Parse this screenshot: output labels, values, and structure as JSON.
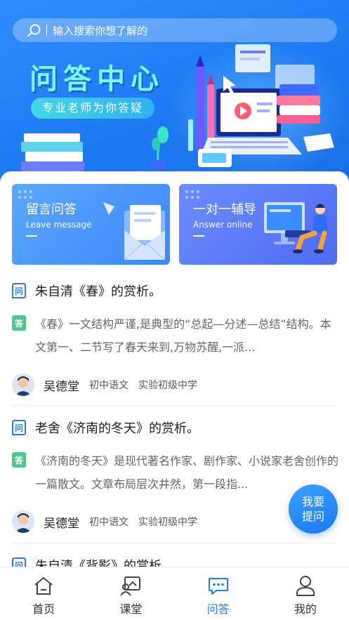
{
  "search": {
    "placeholder": "输入搜索你想了解的"
  },
  "banner": {
    "title": "问答中心",
    "subtitle": "专业老师为你答疑"
  },
  "cards": [
    {
      "title": "留言问答",
      "subtitle": "Leave message"
    },
    {
      "title": "一对一辅导",
      "subtitle": "Answer online"
    }
  ],
  "badges": {
    "question": "问",
    "answer": "答"
  },
  "qa_items": [
    {
      "question": "朱自清《春》的赏析。",
      "answer": "《春》一文结构严谨,是典型的“总起—分述—总结”结构。本文第一、二节写了春天来到,万物苏醒,一派...",
      "teacher": "吴德堂",
      "subject": "初中语文",
      "school": "实验初级中学"
    },
    {
      "question": "老舍《济南的冬天》的赏析。",
      "answer": "《济南的冬天》是现代著名作家、剧作家、小说家老舍创作的一篇散文。文章布局层次井然，第一段指...",
      "teacher": "吴德堂",
      "subject": "初中语文",
      "school": "实验初级中学"
    },
    {
      "question": "朱自清《背影》的赏析"
    }
  ],
  "fab": {
    "line1": "我要",
    "line2": "提问"
  },
  "tabbar": [
    {
      "label": "首页",
      "icon": "home-icon",
      "active": false
    },
    {
      "label": "课堂",
      "icon": "classroom-icon",
      "active": false
    },
    {
      "label": "问答",
      "icon": "chat-icon",
      "active": true
    },
    {
      "label": "我的",
      "icon": "profile-icon",
      "active": false
    }
  ],
  "colors": {
    "primary": "#1f7ef5",
    "answer_badge": "#4cc98a",
    "title_cyan": "#7df6f0"
  }
}
